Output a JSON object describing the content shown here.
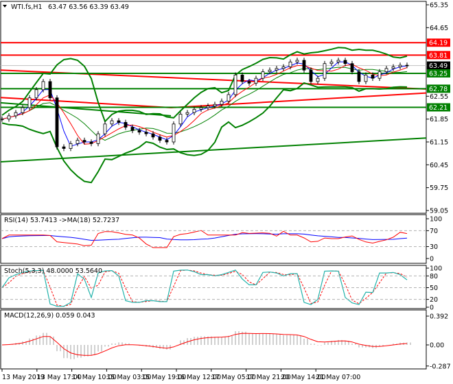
{
  "header": {
    "symbol": "WTI.fs,H1",
    "ohlc": "63.47 63.56 63.39 63.49"
  },
  "colors": {
    "support": "#008000",
    "resistance": "#ff0000",
    "current": "#000000",
    "ma_fast": "#0000ff",
    "ma_slow": "#ff0000",
    "stoch_main": "#20b2aa",
    "macd_hist": "#a0a0a0"
  },
  "chart_data": [
    {
      "type": "line",
      "title": "WTI.fs,H1",
      "ylim": [
        59.05,
        65.35
      ],
      "yticks": [
        "65.35",
        "64.65",
        "62.55",
        "61.85",
        "61.15",
        "60.45",
        "59.75",
        "59.05"
      ],
      "xticks": [
        "13 May 2019",
        "13 May 17:00",
        "14 May 10:00",
        "15 May 03:00",
        "15 May 19:00",
        "16 May 12:00",
        "17 May 05:00",
        "17 May 21:00",
        "20 May 14:00",
        "21 May 07:00"
      ],
      "close": [
        61.85,
        61.95,
        62.05,
        62.2,
        62.5,
        62.75,
        63.0,
        62.5,
        61.0,
        60.95,
        61.1,
        61.2,
        61.15,
        61.1,
        61.4,
        61.7,
        61.8,
        61.75,
        61.6,
        61.5,
        61.45,
        61.4,
        61.3,
        61.2,
        61.15,
        61.7,
        62.0,
        62.05,
        62.15,
        62.2,
        62.25,
        62.3,
        62.4,
        62.6,
        63.2,
        63.0,
        62.95,
        63.1,
        63.3,
        63.35,
        63.4,
        63.45,
        63.6,
        63.65,
        63.35,
        63.0,
        63.1,
        63.55,
        63.6,
        63.65,
        63.55,
        63.3,
        63.0,
        63.2,
        63.1,
        63.3,
        63.4,
        63.45,
        63.5,
        63.49
      ],
      "levels": [
        {
          "value": 64.19,
          "label": "64.19",
          "kind": "resistance"
        },
        {
          "value": 63.81,
          "label": "63.81",
          "kind": "resistance"
        },
        {
          "value": 63.49,
          "label": "63.49",
          "kind": "current"
        },
        {
          "value": 63.25,
          "label": "63.25",
          "kind": "support"
        },
        {
          "value": 62.78,
          "label": "62.78",
          "kind": "support"
        },
        {
          "value": 62.21,
          "label": "62.21",
          "kind": "support"
        }
      ],
      "trendlines": [
        {
          "kind": "resistance",
          "from": [
            0,
            63.35
          ],
          "to": [
            1,
            62.77
          ]
        },
        {
          "kind": "resistance",
          "from": [
            0,
            62.51
          ],
          "to": [
            0.4,
            62.2
          ]
        },
        {
          "kind": "resistance",
          "from": [
            0.4,
            62.2
          ],
          "to": [
            1,
            62.65
          ]
        },
        {
          "kind": "support",
          "from": [
            0,
            62.35
          ],
          "to": [
            0.4,
            61.95
          ]
        },
        {
          "kind": "support",
          "from": [
            0,
            60.54
          ],
          "to": [
            1,
            61.27
          ]
        }
      ]
    },
    {
      "type": "line",
      "title": "RSI(14) 53.7413  ->MA(18) 52.7237",
      "ylim": [
        0,
        100
      ],
      "yticks": [
        "100",
        "70",
        "30",
        "0"
      ],
      "levels": [
        70,
        30
      ]
    },
    {
      "type": "line",
      "title": "Stoch(5,3,3) 48.0000 53.5640",
      "ylim": [
        0,
        100
      ],
      "yticks": [
        "100",
        "80",
        "50",
        "20",
        "0"
      ],
      "levels": [
        80,
        50,
        20
      ]
    },
    {
      "type": "bar",
      "title": "MACD(12,26,9) 0.059 0.043",
      "ylim": [
        -0.287,
        0.392
      ],
      "yticks": [
        "0.392",
        "0.00",
        "-0.287"
      ]
    }
  ]
}
